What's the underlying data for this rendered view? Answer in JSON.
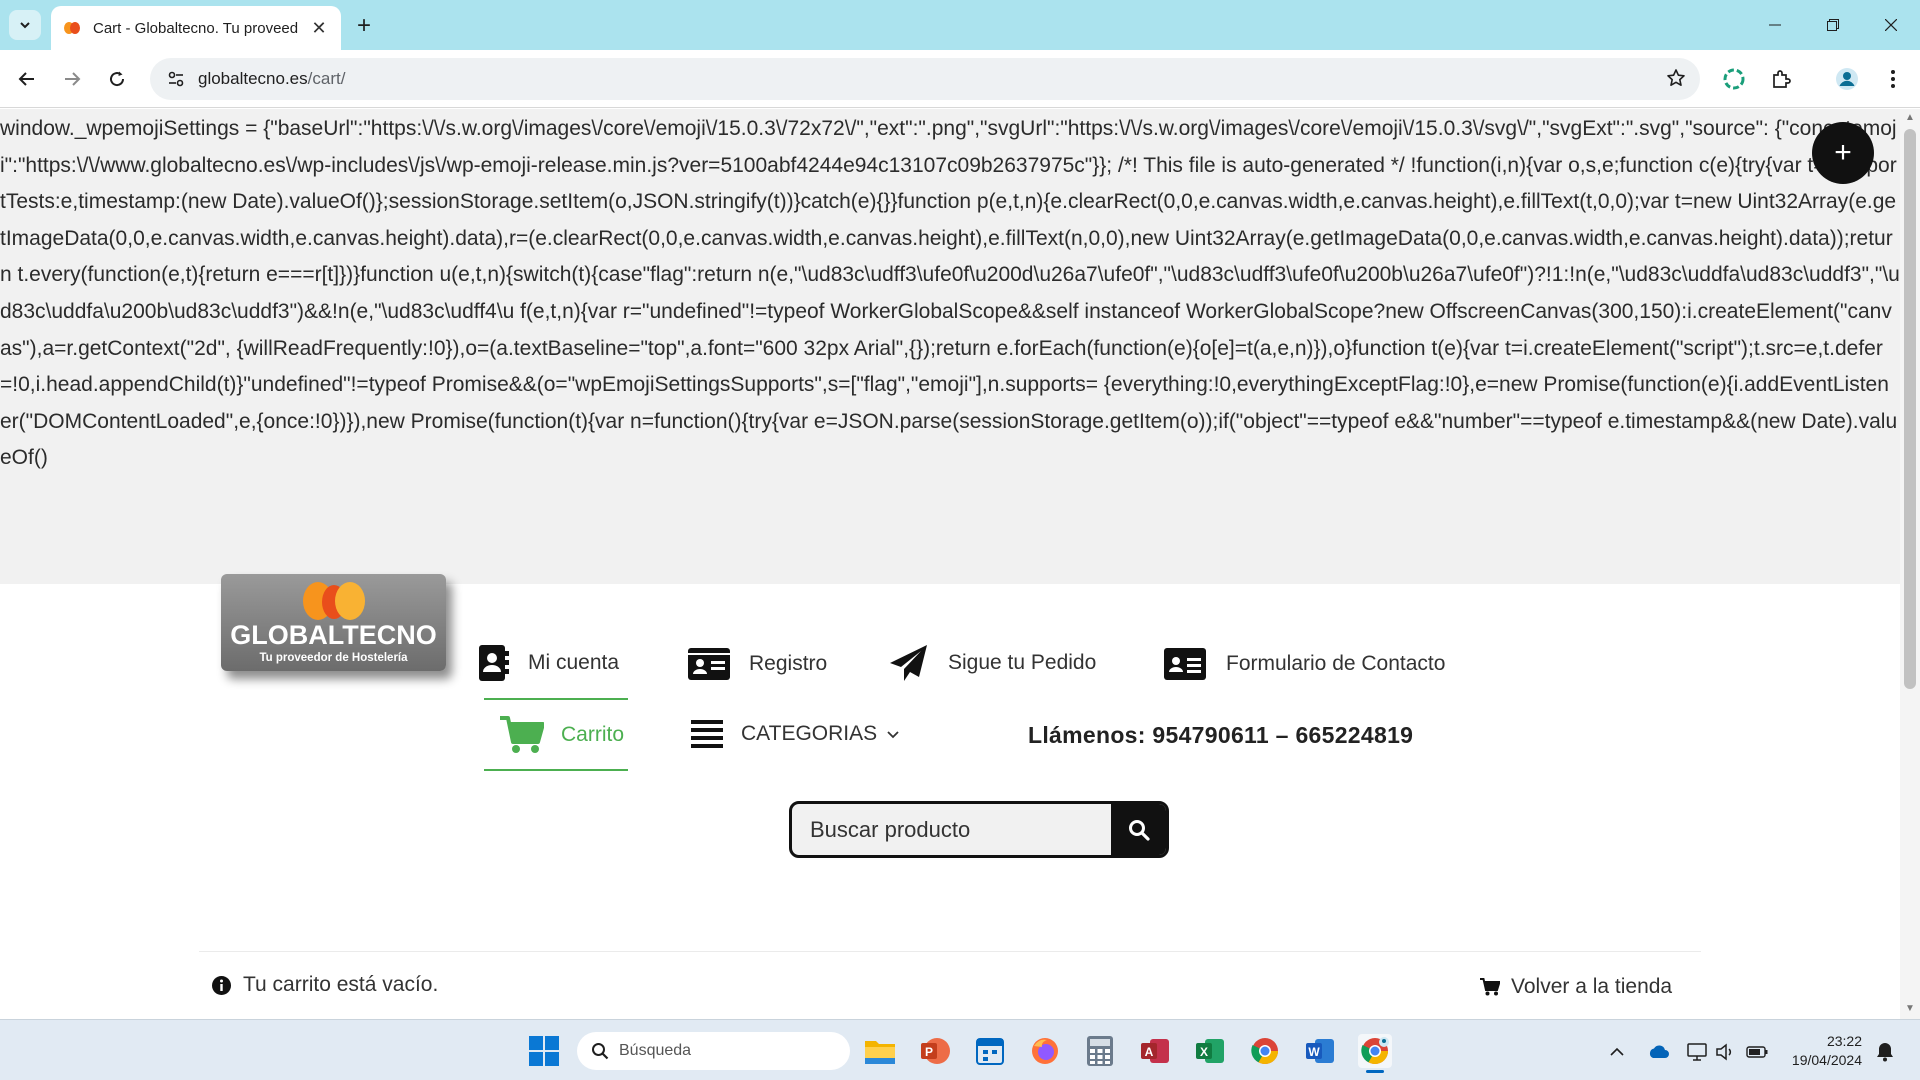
{
  "browser": {
    "tab_title": "Cart - Globaltecno. Tu proveed",
    "url_domain": "globaltecno.es",
    "url_path": "/cart/",
    "window_controls": [
      "minimize",
      "restore",
      "close"
    ]
  },
  "page": {
    "code_text": "window._wpemojiSettings = {\"baseUrl\":\"https:\\/\\/s.w.org\\/images\\/core\\/emoji\\/15.0.3\\/72x72\\/\",\"ext\":\".png\",\"svgUrl\":\"https:\\/\\/s.w.org\\/images\\/core\\/emoji\\/15.0.3\\/svg\\/\",\"svgExt\":\".svg\",\"source\": {\"concatemoji\":\"https:\\/\\/www.globaltecno.es\\/wp-includes\\/js\\/wp-emoji-release.min.js?ver=5100abf4244e94c13107c09b2637975c\"}}; /*! This file is auto-generated */ !function(i,n){var o,s,e;function c(e){try{var t={supportTests:e,timestamp:(new Date).valueOf()};sessionStorage.setItem(o,JSON.stringify(t))}catch(e){}}function p(e,t,n){e.clearRect(0,0,e.canvas.width,e.canvas.height),e.fillText(t,0,0);var t=new Uint32Array(e.getImageData(0,0,e.canvas.width,e.canvas.height).data),r=(e.clearRect(0,0,e.canvas.width,e.canvas.height),e.fillText(n,0,0),new Uint32Array(e.getImageData(0,0,e.canvas.width,e.canvas.height).data));return t.every(function(e,t){return e===r[t]})}function u(e,t,n){switch(t){case\"flag\":return n(e,\"\\ud83c\\udff3\\ufe0f\\u200d\\u26a7\\ufe0f\",\"\\ud83c\\udff3\\ufe0f\\u200b\\u26a7\\ufe0f\")?!1:!n(e,\"\\ud83c\\uddfa\\ud83c\\uddf3\",\"\\ud83c\\uddfa\\u200b\\ud83c\\uddf3\")&&!n(e,\"\\ud83c\\udff4\\u f(e,t,n){var r=\"undefined\"!=typeof WorkerGlobalScope&&self instanceof WorkerGlobalScope?new OffscreenCanvas(300,150):i.createElement(\"canvas\"),a=r.getContext(\"2d\", {willReadFrequently:!0}),o=(a.textBaseline=\"top\",a.font=\"600 32px Arial\",{});return e.forEach(function(e){o[e]=t(a,e,n)}),o}function t(e){var t=i.createElement(\"script\");t.src=e,t.defer=!0,i.head.appendChild(t)}\"undefined\"!=typeof Promise&&(o=\"wpEmojiSettingsSupports\",s=[\"flag\",\"emoji\"],n.supports= {everything:!0,everythingExceptFlag:!0},e=new Promise(function(e){i.addEventListener(\"DOMContentLoaded\",e,{once:!0})}),new Promise(function(t){var n=function(){try{var e=JSON.parse(sessionStorage.getItem(o));if(\"object\"==typeof e&&\"number\"==typeof e.timestamp&&(new Date).valueOf()",
    "fab_label": "+",
    "logo": {
      "name": "GLOBALTECNO",
      "tagline": "Tu proveedor de Hostelería"
    },
    "menu": {
      "mi_cuenta": "Mi cuenta",
      "registro": "Registro",
      "sigue_pedido": "Sigue tu Pedido",
      "contacto": "Formulario de Contacto",
      "carrito": "Carrito",
      "categorias": "CATEGORIAS"
    },
    "phone": "Llámenos: 954790611 – 665224819",
    "search_placeholder": "Buscar producto",
    "empty_cart": "Tu carrito está vacío.",
    "back_to_shop": "Volver a la tienda",
    "accent_color": "#4caf50"
  },
  "taskbar": {
    "search_placeholder": "Búsqueda",
    "time": "23:22",
    "date": "19/04/2024"
  }
}
